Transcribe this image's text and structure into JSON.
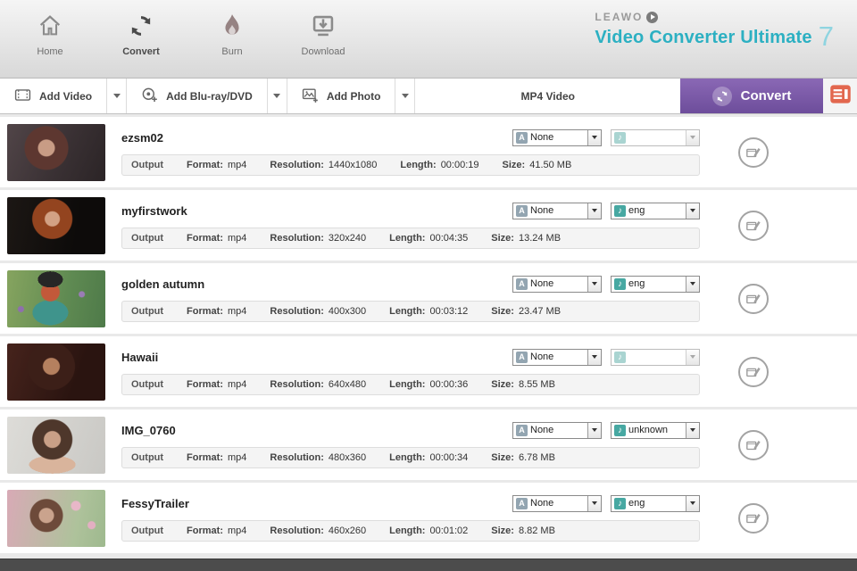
{
  "header": {
    "nav": [
      {
        "label": "Home"
      },
      {
        "label": "Convert"
      },
      {
        "label": "Burn"
      },
      {
        "label": "Download"
      }
    ],
    "brand": {
      "name": "LEAWO",
      "title": "Video Converter Ultimate",
      "version": "7"
    }
  },
  "toolbar": {
    "add_video": "Add Video",
    "add_bluray": "Add Blu-ray/DVD",
    "add_photo": "Add Photo",
    "format_selected": "MP4 Video",
    "convert_label": "Convert"
  },
  "labels": {
    "output": "Output",
    "format": "Format:",
    "resolution": "Resolution:",
    "length": "Length:",
    "size": "Size:"
  },
  "colors": {
    "accent_teal": "#2cb0c2",
    "convert_purple": "#7b5aa6",
    "panel_orange": "#e2674e"
  },
  "rows": [
    {
      "title": "ezsm02",
      "subtitle": "None",
      "audio": "",
      "format": "mp4",
      "resolution": "1440x1080",
      "length": "00:00:19",
      "size": "41.50 MB"
    },
    {
      "title": "myfirstwork",
      "subtitle": "None",
      "audio": "eng",
      "format": "mp4",
      "resolution": "320x240",
      "length": "00:04:35",
      "size": "13.24 MB"
    },
    {
      "title": "golden autumn",
      "subtitle": "None",
      "audio": "eng",
      "format": "mp4",
      "resolution": "400x300",
      "length": "00:03:12",
      "size": "23.47 MB"
    },
    {
      "title": "Hawaii",
      "subtitle": "None",
      "audio": "",
      "format": "mp4",
      "resolution": "640x480",
      "length": "00:00:36",
      "size": "8.55 MB"
    },
    {
      "title": "IMG_0760",
      "subtitle": "None",
      "audio": "unknown",
      "format": "mp4",
      "resolution": "480x360",
      "length": "00:00:34",
      "size": "6.78 MB"
    },
    {
      "title": "FessyTrailer",
      "subtitle": "None",
      "audio": "eng",
      "format": "mp4",
      "resolution": "460x260",
      "length": "00:01:02",
      "size": "8.82 MB"
    }
  ]
}
